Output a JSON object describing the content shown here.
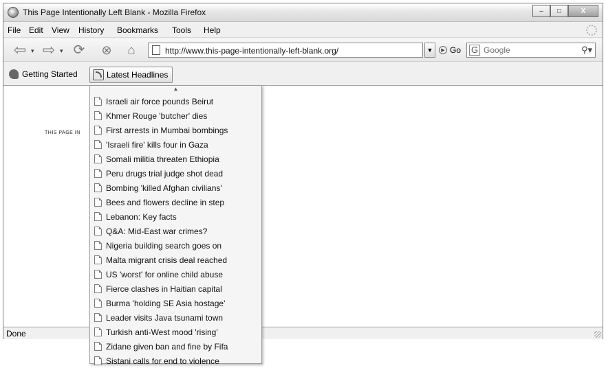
{
  "window": {
    "title": "This Page Intentionally Left Blank - Mozilla Firefox",
    "controls": {
      "minimize": "–",
      "maximize": "□",
      "close": "X"
    }
  },
  "menubar": {
    "items": [
      "File",
      "Edit",
      "View",
      "History",
      "Bookmarks",
      "Tools",
      "Help"
    ]
  },
  "navbar": {
    "url": "http://www.this-page-intentionally-left-blank.org/",
    "go_label": "Go",
    "search_placeholder": "Google"
  },
  "bookmarks": {
    "getting_started": "Getting Started",
    "latest_headlines": "Latest Headlines"
  },
  "content": {
    "page_text": "THIS PAGE IN"
  },
  "statusbar": {
    "text": "Done"
  },
  "headlines": [
    "Israeli air force pounds Beirut",
    "Khmer Rouge 'butcher' dies",
    "First arrests in Mumbai bombings",
    "'Israeli fire' kills four in Gaza",
    "Somali militia threaten Ethiopia",
    "Peru drugs trial judge shot dead",
    "Bombing 'killed Afghan civilians'",
    "Bees and flowers decline in step",
    "Lebanon: Key facts",
    "Q&A: Mid-East war crimes?",
    "Nigeria building search goes on",
    "Malta migrant crisis deal reached",
    "US 'worst' for online child abuse",
    "Fierce clashes in Haitian capital",
    "Burma 'holding SE Asia hostage'",
    "Leader visits Java tsunami town",
    "Turkish anti-West mood 'rising'",
    "Zidane given ban and fine by Fifa",
    "Sistani calls for end to violence"
  ]
}
